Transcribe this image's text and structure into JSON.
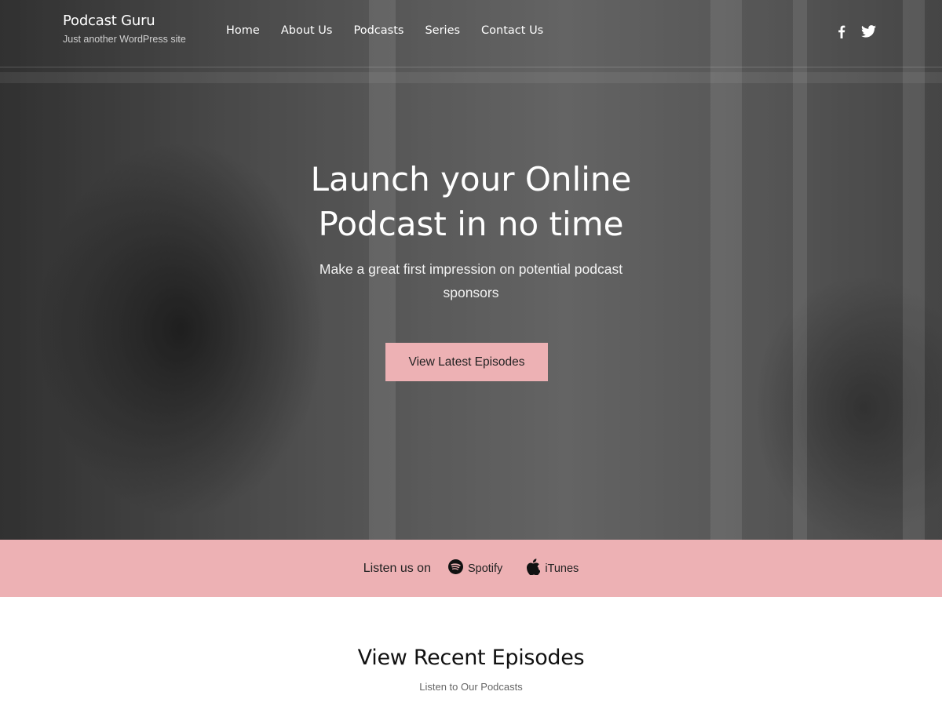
{
  "header": {
    "site_title": "Podcast Guru",
    "tagline": "Just another WordPress site",
    "nav": [
      "Home",
      "About Us",
      "Podcasts",
      "Series",
      "Contact Us"
    ],
    "social_icons": [
      "facebook-icon",
      "twitter-icon"
    ]
  },
  "hero": {
    "title": "Launch your Online Podcast in no time",
    "subtitle": "Make a great first impression on potential podcast sponsors",
    "button_label": "View Latest Episodes"
  },
  "listen_bar": {
    "label": "Listen us on",
    "platforms": [
      {
        "name": "Spotify",
        "icon": "spotify-icon"
      },
      {
        "name": "iTunes",
        "icon": "apple-icon"
      }
    ]
  },
  "recent": {
    "title": "View Recent Episodes",
    "subtitle": "Listen to Our Podcasts"
  },
  "colors": {
    "accent": "#edb1b4",
    "text_dark": "#111111",
    "muted": "#666666"
  }
}
